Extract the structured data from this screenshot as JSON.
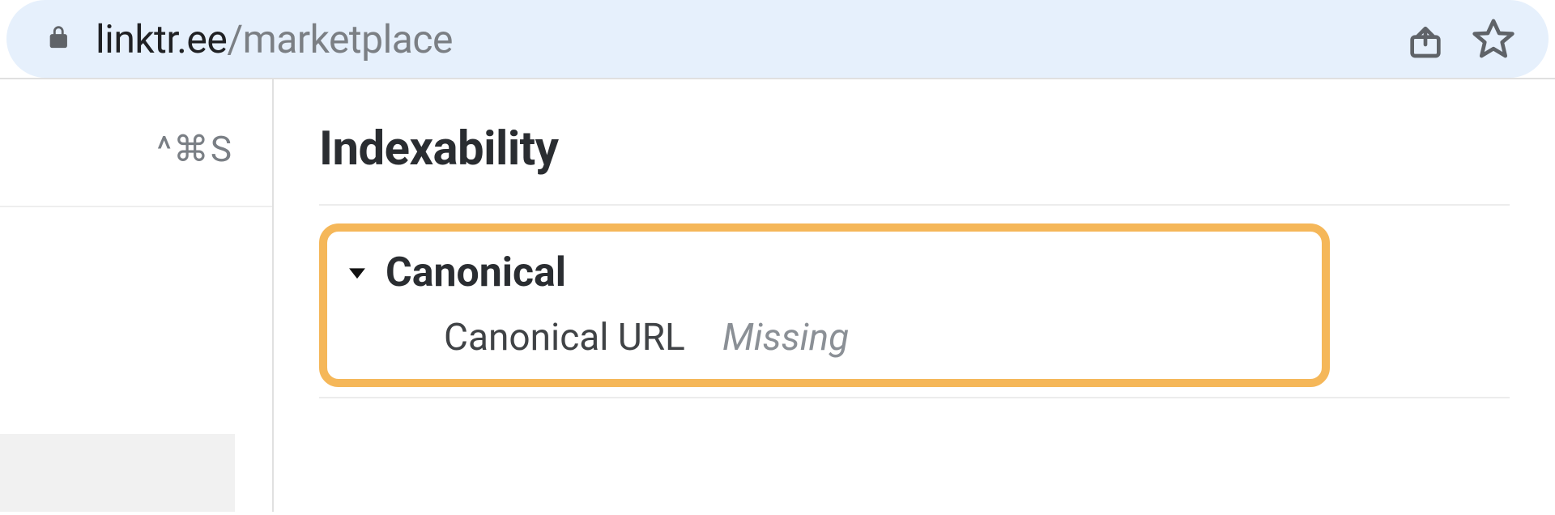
{
  "addressBar": {
    "domain": "linktr.ee",
    "path": "/marketplace"
  },
  "sidebar": {
    "shortcut": "^⌘S"
  },
  "section": {
    "title": "Indexability",
    "canonical": {
      "header": "Canonical",
      "row_label": "Canonical URL",
      "row_value": "Missing"
    }
  }
}
